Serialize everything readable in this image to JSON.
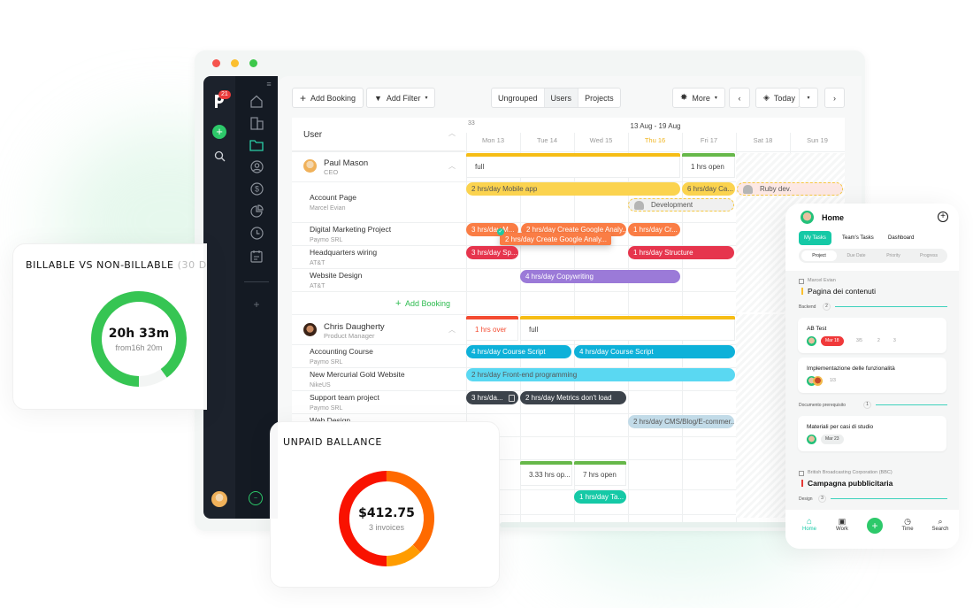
{
  "window": {
    "traffic_lights": [
      "#f5544d",
      "#fbbf2f",
      "#3cc84a"
    ]
  },
  "rail": {
    "logo_icon": "paymo-logo-icon",
    "notification_count": "21",
    "add_icon": "plus-icon",
    "search_icon": "search-icon",
    "nav_icons": [
      "home-icon",
      "building-icon",
      "folder-icon",
      "user-circle-icon",
      "dollar-icon",
      "pie-chart-icon",
      "clock-icon",
      "calendar-icon"
    ],
    "active_nav": "folder-icon",
    "expand_icon": "menu-expand-icon",
    "add_more_icon": "plus-icon"
  },
  "toolbar": {
    "add_booking": "Add Booking",
    "add_filter": "Add Filter",
    "grouping": [
      "Ungrouped",
      "Users",
      "Projects"
    ],
    "grouping_selected": "Users",
    "more": "More",
    "today": "Today"
  },
  "schedule": {
    "column_header": "User",
    "week_number": "33",
    "date_range": "13 Aug - 19 Aug",
    "days": [
      "Mon 13",
      "Tue 14",
      "Wed 15",
      "Thu 16",
      "Fri 17",
      "Sat 18",
      "Sun 19"
    ],
    "today": "Thu 16",
    "add_booking": "Add Booking",
    "users": [
      {
        "name": "Paul Mason",
        "role": "CEO",
        "capacity": [
          {
            "label": "full",
            "status": "full",
            "color": "#f6bd16"
          },
          {
            "label": "1 hrs open",
            "status": "open",
            "color": "#67b84a"
          }
        ],
        "projects": [
          {
            "name": "Account Page",
            "client": "Marcel Evian"
          },
          {
            "name": "Digital Marketing Project",
            "client": "Paymo SRL"
          },
          {
            "name": "Headquarters wiring",
            "client": "AT&T"
          },
          {
            "name": "Website Design",
            "client": "AT&T"
          }
        ],
        "bookings": [
          {
            "label": "2 hrs/day Mobile app",
            "color": "#fbd34f"
          },
          {
            "label": "6 hrs/day Ca...",
            "color": "#fbd34f"
          },
          {
            "label": "Ruby dev.",
            "color": "#fde8e4",
            "placeholder": true
          },
          {
            "label": "Development",
            "color": "#f0f0f0",
            "placeholder": true
          },
          {
            "label": "3 hrs/day M...",
            "color": "#fa7d45"
          },
          {
            "label": "2 hrs/day Create Google Analy...",
            "color": "#fa7d45"
          },
          {
            "label": "1 hrs/day Cr...",
            "color": "#fa7d45"
          },
          {
            "label": "2 hrs/day Create Google Analy...",
            "color": "#fa7d45",
            "dragging": true
          },
          {
            "label": "3 hrs/day Sp...",
            "color": "#e6354d"
          },
          {
            "label": "1 hrs/day Structure",
            "color": "#e6354d"
          },
          {
            "label": "4 hrs/day Copywriting",
            "color": "#9b7ad8"
          }
        ]
      },
      {
        "name": "Chris Daugherty",
        "role": "Product Manager",
        "capacity": [
          {
            "label": "1 hrs over",
            "status": "over",
            "color": "#f44b31"
          },
          {
            "label": "full",
            "status": "full",
            "color": "#f6bd16"
          }
        ],
        "projects": [
          {
            "name": "Accounting Course",
            "client": "Paymo SRL"
          },
          {
            "name": "New Mercurial Gold Website",
            "client": "NikeUS"
          },
          {
            "name": "Support team project",
            "client": "Paymo SRL"
          },
          {
            "name": "Web Design",
            "client": ""
          }
        ],
        "bookings": [
          {
            "label": "4 hrs/day Course Script",
            "color": "#0eb1d9"
          },
          {
            "label": "4 hrs/day Course Script",
            "color": "#0eb1d9"
          },
          {
            "label": "2 hrs/day Front-end programming",
            "color": "#5ad8f2"
          },
          {
            "label": "3 hrs/da...",
            "color": "#3c434b"
          },
          {
            "label": "2 hrs/day Metrics don't load",
            "color": "#3c434b"
          },
          {
            "label": "2 hrs/day CMS/Blog/E-commer...",
            "color": "#c2dbe8"
          }
        ]
      },
      {
        "capacity": [
          {
            "label": "3.33 hrs op...",
            "status": "open",
            "color": "#67b84a"
          },
          {
            "label": "7 hrs open",
            "status": "open",
            "color": "#67b84a"
          }
        ],
        "bookings": [
          {
            "label": "1 hrs/day Ta...",
            "color": "#15c9a6"
          }
        ]
      }
    ]
  },
  "billable_card": {
    "title": "BILLABLE VS NON-BILLABLE",
    "title_suffix": "(30 D",
    "value": "20h 33m",
    "subtitle": "from16h 20m",
    "billable_fraction": 0.9,
    "colors": {
      "billable": "#36c553",
      "non_billable": "#f3f5f4"
    }
  },
  "unpaid_card": {
    "title": "UNPAID BALLANCE",
    "value": "$412.75",
    "subtitle": "3 invoices",
    "segments": [
      {
        "fraction": 0.375,
        "color": "#ff6a00"
      },
      {
        "fraction": 0.125,
        "color": "#ff9c00"
      },
      {
        "fraction": 0.5,
        "color": "#f91200"
      }
    ]
  },
  "mobile": {
    "title": "Home",
    "tabs": [
      "My Tasks",
      "Team's Tasks",
      "Dashboard"
    ],
    "active_tab": "My Tasks",
    "sort": [
      "Project",
      "Due Date",
      "Priority",
      "Progress"
    ],
    "active_sort": "Project",
    "groups": [
      {
        "client": "Marcel Evian",
        "project": "Pagina dei contenuti",
        "priority_color": "#fbc02d",
        "sections": [
          {
            "name": "Backend",
            "count": "2",
            "tasks": [
              {
                "title": "AB Test",
                "due": "Mar 18",
                "due_overdue": true,
                "subtasks": "3/5",
                "comments": "2",
                "files": "3"
              },
              {
                "title": "Implementazione delle funzionalità",
                "subtasks": "1/3"
              }
            ]
          },
          {
            "name": "Documento prerequisito",
            "count": "1",
            "tasks": [
              {
                "title": "Materiali per casi di studio",
                "due": "Mar 23"
              }
            ]
          }
        ]
      },
      {
        "client": "British Broadcasting Corporation (BBC)",
        "project": "Campagna pubblicitaria",
        "priority_color": "#e53935",
        "sections": [
          {
            "name": "Design",
            "count": "3"
          }
        ]
      }
    ],
    "bottom_nav": [
      "Home",
      "Work",
      "",
      "Time",
      "Search"
    ],
    "active_nav": "Home",
    "accent": "#15c9a6"
  }
}
